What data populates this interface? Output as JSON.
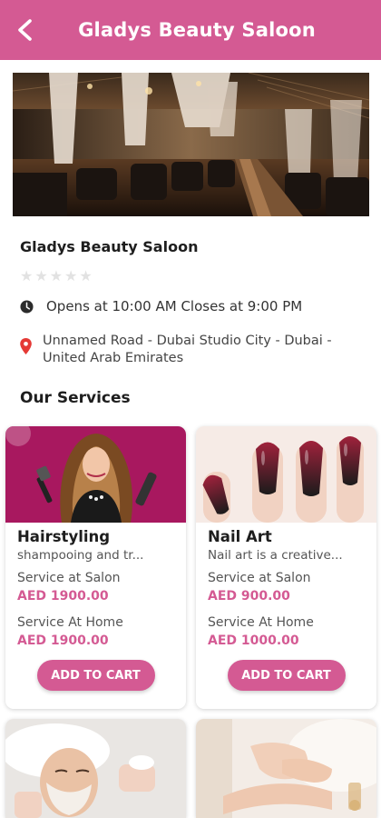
{
  "header": {
    "title": "Gladys Beauty Saloon"
  },
  "salon": {
    "name": "Gladys Beauty Saloon",
    "rating": 0,
    "hours": "Opens at 10:00 AM Closes at 9:00 PM",
    "address": "Unnamed Road - Dubai Studio City - Dubai - United Arab Emirates"
  },
  "services_title": "Our Services",
  "services": [
    {
      "name": "Hairstyling",
      "description": "shampooing and tr...",
      "salon_label": "Service at Salon",
      "salon_price": "AED 1900.00",
      "home_label": "Service At Home",
      "home_price": "AED 1900.00",
      "button": "ADD TO CART"
    },
    {
      "name": "Nail Art",
      "description": "Nail art is a creative...",
      "salon_label": "Service at Salon",
      "salon_price": "AED 900.00",
      "home_label": "Service At Home",
      "home_price": "AED 1000.00",
      "button": "ADD TO CART"
    }
  ],
  "colors": {
    "accent": "#d45a93",
    "star_empty": "#e2e2e2",
    "location_pin": "#e53935"
  },
  "icons": {
    "back": "arrow-left-icon",
    "clock": "clock-icon",
    "location": "location-pin-icon",
    "star": "star-icon"
  }
}
